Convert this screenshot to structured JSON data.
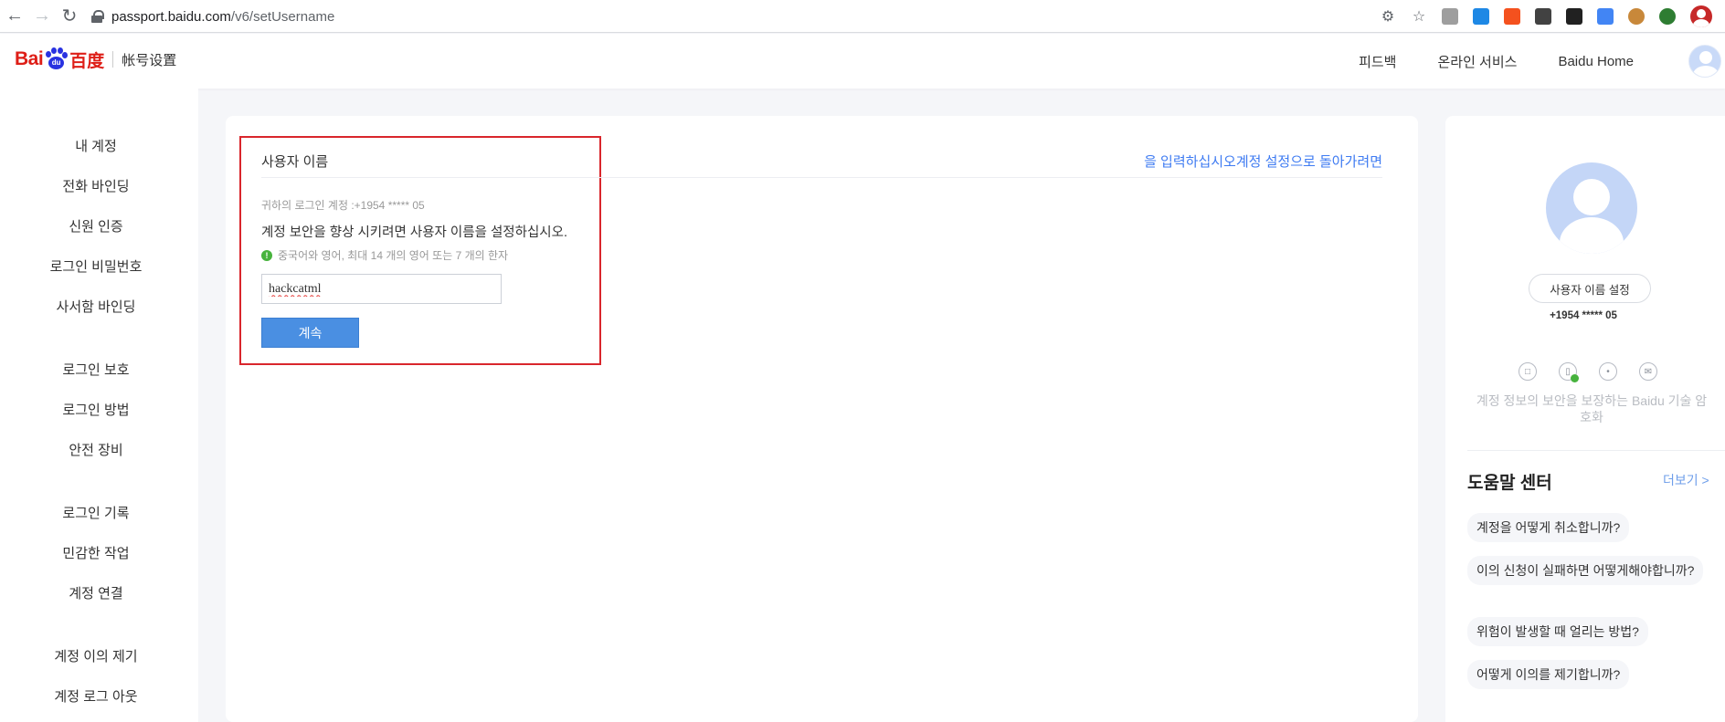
{
  "browser": {
    "url_host": "passport.baidu.com",
    "url_path": "/v6/setUsername",
    "back_icon": "arrow-left-icon",
    "forward_icon": "arrow-right-icon",
    "reload_icon": "reload-icon"
  },
  "header": {
    "logo_left": "Bai",
    "logo_right": "百度",
    "logo_paw_text": "du",
    "subtitle": "帐号设置",
    "links": [
      "피드백",
      "온라인 서비스",
      "Baidu Home"
    ]
  },
  "sidebar": {
    "items": [
      "내 계정",
      "전화 바인딩",
      "신원 인증",
      "로그인 비밀번호",
      "사서함 바인딩",
      "로그인 보호",
      "로그인 방법",
      "안전 장비",
      "로그인 기록",
      "민감한 작업",
      "계정 연결",
      "계정 이의 제기",
      "계정 로그 아웃"
    ]
  },
  "main": {
    "title": "사용자 이름",
    "back_link": "을 입력하십시오계정 설정으로 돌아가려면",
    "account_line": "귀하의 로그인 계정 :+1954 ***** 05",
    "prompt": "계정 보안을 향상 시키려면 사용자 이름을 설정하십시오.",
    "hint": "중국어와 영어, 최대 14 개의 영어 또는 7 개의 한자",
    "username_value": "hackcatml",
    "continue_label": "계속"
  },
  "right_panel": {
    "set_name_label": "사용자 이름 설정",
    "phone": "+1954 ***** 05",
    "security_text": "계정 정보의 보안을 보장하는 Baidu 기술 암호화",
    "help_title": "도움말 센터",
    "help_more": "더보기 >",
    "help_items": [
      "계정을 어떻게 취소합니까?",
      "이의 신청이 실패하면 어떻게해야합니까?",
      "위험이 발생할 때 얼리는 방법?",
      "어떻게 이의를 제기합니까?"
    ]
  },
  "colors": {
    "accent_red": "#d9262c",
    "link_blue": "#3e7bf2",
    "button_blue": "#4a8fe2"
  }
}
